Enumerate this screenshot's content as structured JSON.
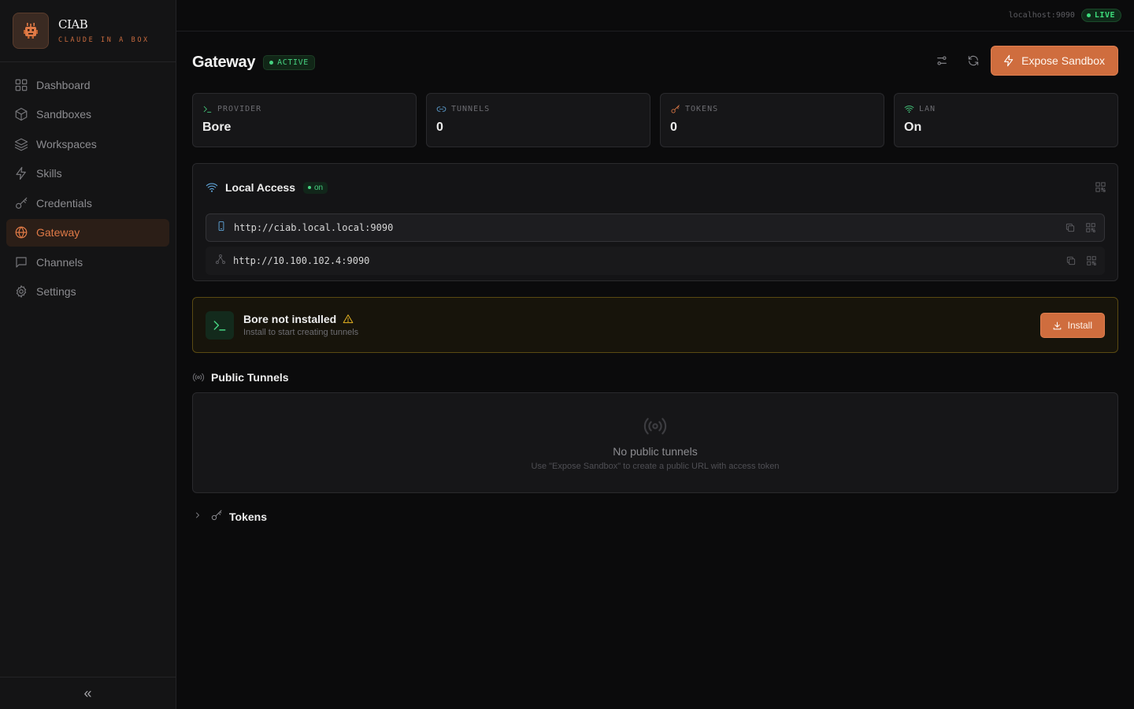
{
  "brand": {
    "title": "CIAB",
    "subtitle": "CLAUDE IN A BOX",
    "logo_icon": "robot-icon"
  },
  "sidebar": {
    "items": [
      {
        "label": "Dashboard",
        "icon": "grid-icon",
        "active": false
      },
      {
        "label": "Sandboxes",
        "icon": "box-icon",
        "active": false
      },
      {
        "label": "Workspaces",
        "icon": "layers-icon",
        "active": false
      },
      {
        "label": "Skills",
        "icon": "bolt-icon",
        "active": false
      },
      {
        "label": "Credentials",
        "icon": "key-icon",
        "active": false
      },
      {
        "label": "Gateway",
        "icon": "globe-icon",
        "active": true
      },
      {
        "label": "Channels",
        "icon": "chat-icon",
        "active": false
      },
      {
        "label": "Settings",
        "icon": "gear-icon",
        "active": false
      }
    ],
    "collapse_glyph": "«"
  },
  "topbar": {
    "host": "localhost:9090",
    "live_label": "LIVE"
  },
  "header": {
    "title": "Gateway",
    "status": "ACTIVE",
    "expose_label": "Expose Sandbox"
  },
  "stats": [
    {
      "label": "PROVIDER",
      "value": "Bore",
      "icon": "terminal-icon",
      "color": "#46d281"
    },
    {
      "label": "TUNNELS",
      "value": "0",
      "icon": "link-icon",
      "color": "#5fa4d8"
    },
    {
      "label": "TOKENS",
      "value": "0",
      "icon": "key-icon",
      "color": "#e07a47"
    },
    {
      "label": "LAN",
      "value": "On",
      "icon": "wifi-icon",
      "color": "#46d281"
    }
  ],
  "local_access": {
    "title": "Local Access",
    "badge": "on",
    "urls": [
      {
        "url": "http://ciab.local.local:9090",
        "icon": "phone-icon"
      },
      {
        "url": "http://10.100.102.4:9090",
        "icon": "network-icon"
      }
    ]
  },
  "warning": {
    "title": "Bore not installed",
    "subtitle": "Install to start creating tunnels",
    "install_label": "Install"
  },
  "public_tunnels": {
    "title": "Public Tunnels",
    "empty_title": "No public tunnels",
    "empty_subtitle": "Use \"Expose Sandbox\" to create a public URL with access token"
  },
  "tokens": {
    "title": "Tokens"
  },
  "colors": {
    "accent": "#cf6d3e",
    "success": "#46d281",
    "warning": "#e6b422"
  }
}
